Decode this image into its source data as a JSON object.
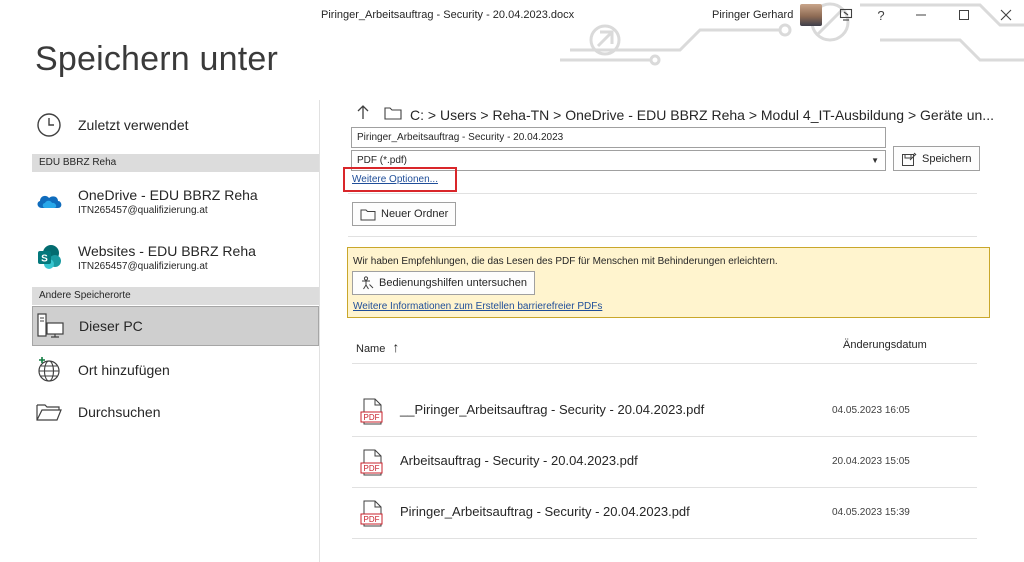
{
  "window": {
    "document_title": "Piringer_Arbeitsauftrag - Security - 20.04.2023.docx",
    "user_name": "Piringer Gerhard"
  },
  "page_title": "Speichern unter",
  "nav": {
    "recent_label": "Zuletzt verwendet",
    "org_section": "EDU BBRZ Reha",
    "onedrive": {
      "name": "OneDrive - EDU BBRZ Reha",
      "email": "ITN265457@qualifizierung.at"
    },
    "sites": {
      "name": "Websites - EDU BBRZ Reha",
      "email": "ITN265457@qualifizierung.at"
    },
    "other_section": "Andere Speicherorte",
    "this_pc": "Dieser PC",
    "add_place": "Ort hinzufügen",
    "browse": "Durchsuchen"
  },
  "location": {
    "breadcrumb": "C: > Users > Reha-TN > OneDrive - EDU BBRZ Reha > Modul 4_IT-Ausbildung > Geräte un..."
  },
  "form": {
    "filename": "Piringer_Arbeitsauftrag - Security - 20.04.2023",
    "filetype": "PDF (*.pdf)",
    "save_label": "Speichern",
    "more_options": "Weitere Optionen...",
    "new_folder": "Neuer Ordner"
  },
  "accessibility": {
    "message": "Wir haben Empfehlungen, die das Lesen des PDF für Menschen mit Behinderungen erleichtern.",
    "check_button": "Bedienungshilfen untersuchen",
    "info_link": "Weitere Informationen zum Erstellen barrierefreier PDFs"
  },
  "file_list": {
    "col_name": "Name",
    "col_sort_glyph": "↑",
    "col_modified": "Änderungsdatum",
    "icon_label": "PDF",
    "files": [
      {
        "name": "__Piringer_Arbeitsauftrag - Security - 20.04.2023.pdf",
        "modified": "04.05.2023 16:05"
      },
      {
        "name": "Arbeitsauftrag - Security - 20.04.2023.pdf",
        "modified": "20.04.2023 15:05"
      },
      {
        "name": "Piringer_Arbeitsauftrag - Security - 20.04.2023.pdf",
        "modified": "04.05.2023 15:39"
      }
    ]
  },
  "colors": {
    "accent_link": "#1f4e99",
    "highlight_box": "#d9262a",
    "notice_bg": "#fff4ce",
    "pdf_red": "#c8202b",
    "onedrive_blue": "#0f6cbd",
    "sharepoint_teal": "#03787c"
  }
}
